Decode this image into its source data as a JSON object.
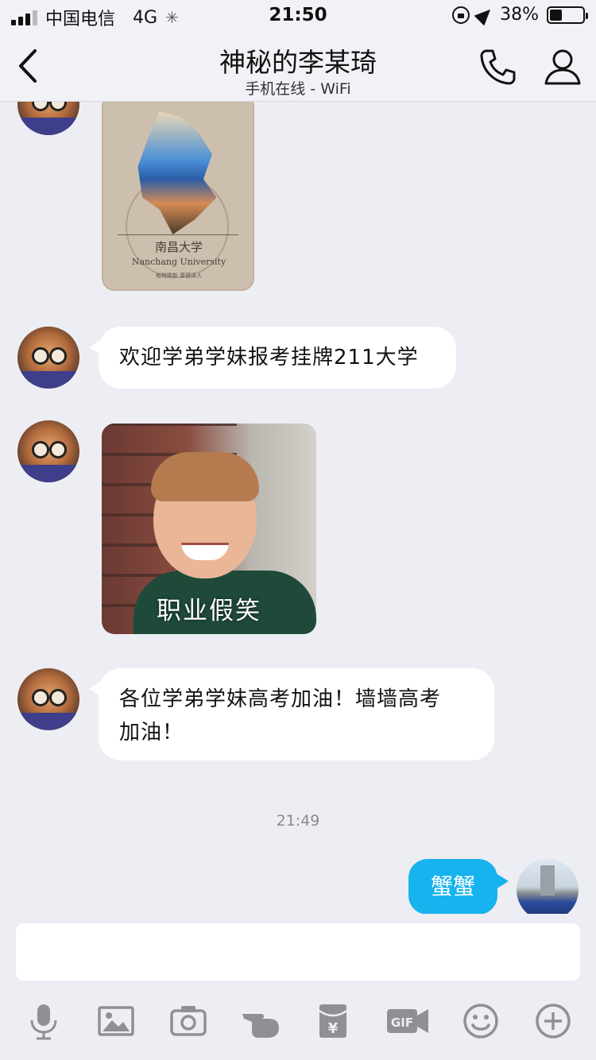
{
  "status_bar": {
    "carrier": "中国电信",
    "network": "4G",
    "time": "21:50",
    "battery": "38%",
    "battery_level": 0.38
  },
  "header": {
    "title": "神秘的李某琦",
    "subtitle": "手机在线 - WiFi"
  },
  "messages": {
    "ncu_card": {
      "name_cn": "南昌大学",
      "name_en": "Nanchang University",
      "motto": "格物致新 厚德泽人"
    },
    "text1": "欢迎学弟学妹报考挂牌211大学",
    "boy_image": {
      "caption": "职业假笑"
    },
    "text2_line1": "各位学弟学妹高考加油！墙墙高考",
    "text2_line2": "加油！",
    "timestamp": "21:49",
    "outgoing": "蟹蟹"
  },
  "input": {
    "placeholder": ""
  },
  "colors": {
    "accent": "#17b3ee",
    "background": "#eceef3",
    "icon": "#8e9096"
  },
  "icons": [
    "mic-icon",
    "image-icon",
    "camera-icon",
    "poke-icon",
    "red-packet-icon",
    "gif-icon",
    "emoji-icon",
    "plus-icon"
  ]
}
